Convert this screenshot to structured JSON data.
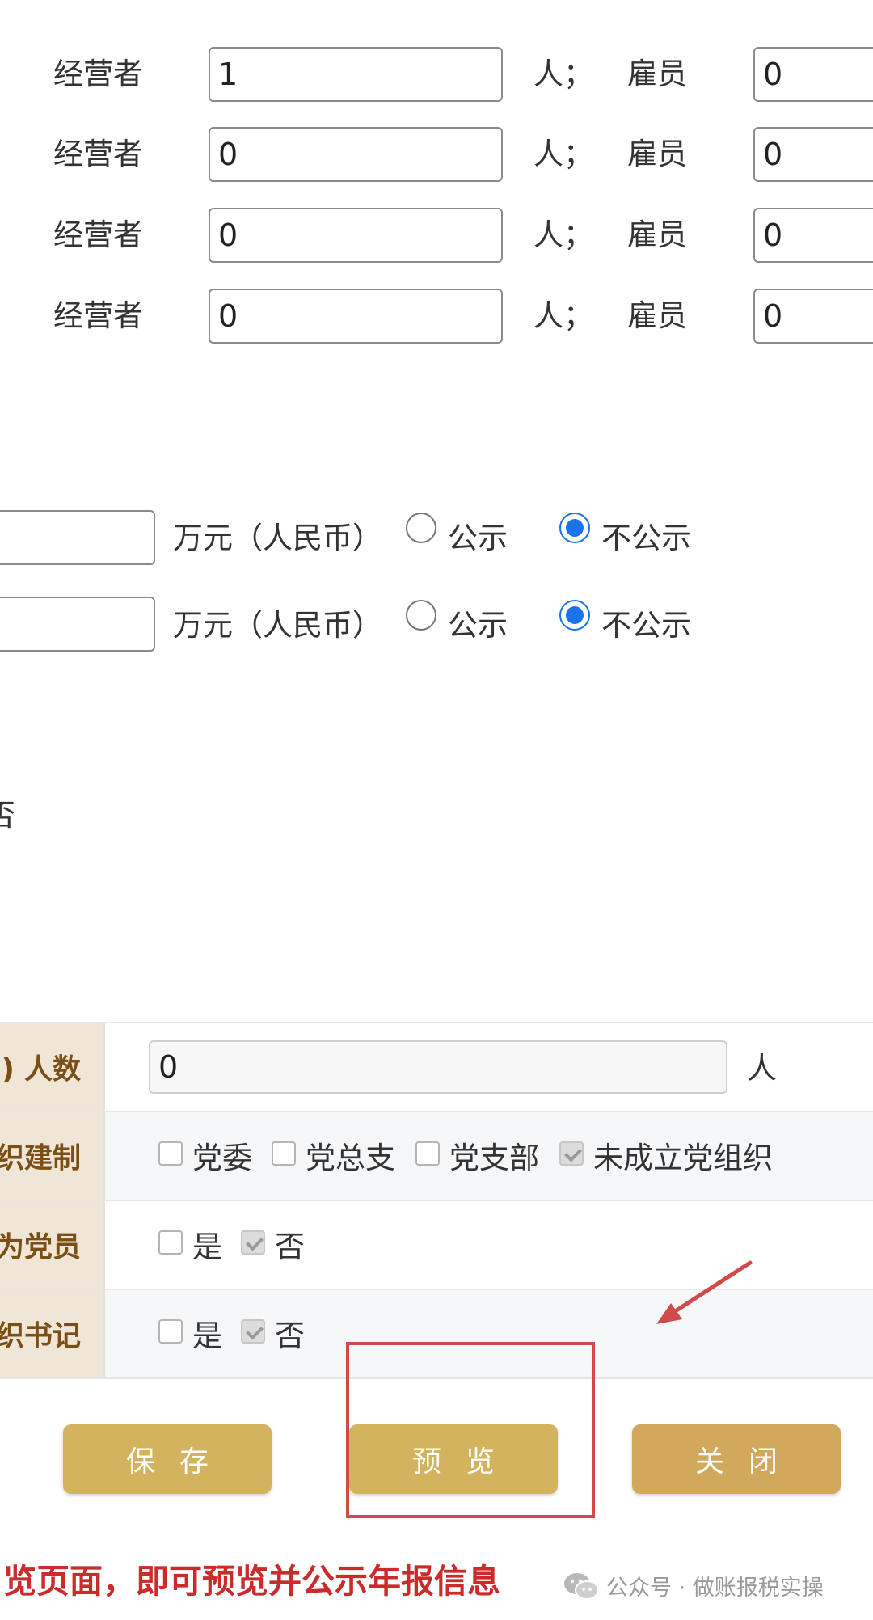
{
  "staff_rows": [
    {
      "operator_label": "经营者",
      "operator_value": "1",
      "unit_sep": "人；",
      "employee_label": "雇员",
      "employee_value": "0"
    },
    {
      "operator_label": "经营者",
      "operator_value": "0",
      "unit_sep": "人；",
      "employee_label": "雇员",
      "employee_value": "0"
    },
    {
      "operator_label": "经营者",
      "operator_value": "0",
      "unit_sep": "人；",
      "employee_label": "雇员",
      "employee_value": "0"
    },
    {
      "operator_label": "经营者",
      "operator_value": "0",
      "unit_sep": "人；",
      "employee_label": "雇员",
      "employee_value": "0"
    }
  ],
  "money_rows": [
    {
      "unit": "万元（人民币）",
      "public_label": "公示",
      "private_label": "不公示",
      "selected": "不公示"
    },
    {
      "unit": "万元（人民币）",
      "public_label": "公示",
      "private_label": "不公示",
      "selected": "不公示"
    }
  ],
  "partial_text": "否",
  "party_section": {
    "member_count": {
      "header": ")  人数",
      "value": "0",
      "unit": "人"
    },
    "org_setup": {
      "header": "织建制",
      "options": [
        {
          "label": "党委",
          "checked": false
        },
        {
          "label": "党总支",
          "checked": false
        },
        {
          "label": "党支部",
          "checked": false
        },
        {
          "label": "未成立党组织",
          "checked": true
        }
      ]
    },
    "is_member": {
      "header": "为党员",
      "yes_label": "是",
      "no_label": "否",
      "selected": "否"
    },
    "org_secretary": {
      "header": "织书记",
      "yes_label": "是",
      "no_label": "否",
      "selected": "否"
    }
  },
  "buttons": {
    "save": "保存",
    "preview": "预览",
    "close": "关闭"
  },
  "annotation": {
    "color": "#d14a4a",
    "notice": "览页面，即可预览并公示年报信息"
  },
  "watermark": {
    "text": "公众号 · 做账报税实操",
    "icon": "wechat-icon"
  },
  "colors": {
    "accent_blue": "#1a73e8",
    "button_gold": "#d4b35e",
    "header_brown": "#7a4e14",
    "header_bg": "#efe6d8"
  }
}
